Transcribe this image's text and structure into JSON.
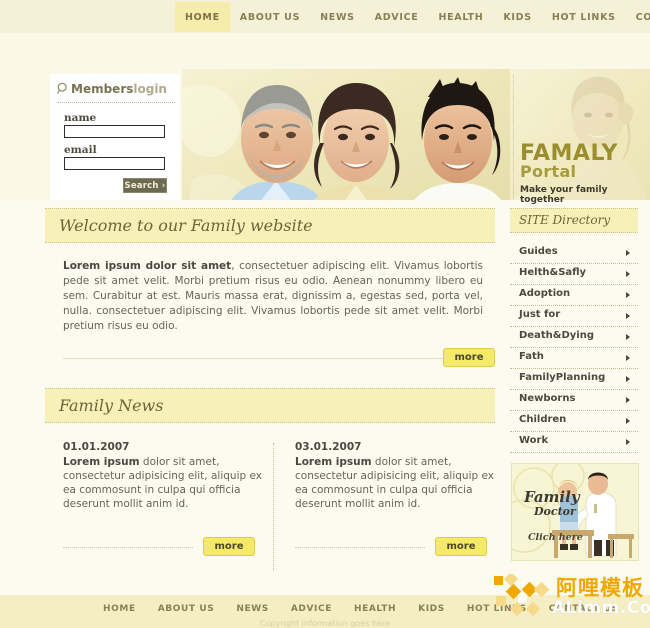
{
  "topnav": {
    "items": [
      {
        "label": "HOME",
        "active": true
      },
      {
        "label": "ABOUT US",
        "active": false
      },
      {
        "label": "NEWS",
        "active": false
      },
      {
        "label": "ADVICE",
        "active": false
      },
      {
        "label": "HEALTH",
        "active": false
      },
      {
        "label": "KIDS",
        "active": false
      },
      {
        "label": "HOT LINKS",
        "active": false
      },
      {
        "label": "CONTACT US",
        "active": false
      }
    ]
  },
  "login": {
    "title_strong": "Members",
    "title_light": "login",
    "icon": "magnifier-icon",
    "name_label": "name",
    "name_value": "",
    "email_label": "email",
    "email_value": "",
    "search_label": "Search ›"
  },
  "banner": {
    "line1": "FAMALY",
    "line2": "Portal",
    "tagline": "Make your family together"
  },
  "welcome": {
    "heading": "Welcome to our Family website",
    "lead": "Lorem ipsum dolor sit amet",
    "body": ", consectetuer adipiscing elit. Vivamus lobortis pede sit amet velit. Morbi pretium risus eu odio. Aenean nonummy libero eu sem. Curabitur at est. Mauris massa erat, dignissim a, egestas sed, porta vel, nulla. consectetuer adipiscing elit. Vivamus lobortis pede sit amet velit. Morbi pretium risus eu odio.",
    "more_label": "more"
  },
  "news": {
    "heading": "Family News",
    "items": [
      {
        "date": "01.01.2007",
        "lead": "Lorem ipsum",
        "body": " dolor sit amet, consectetur adipisicing elit, aliquip ex ea commosunt in culpa qui officia deserunt mollit anim id.",
        "more_label": "more"
      },
      {
        "date": "03.01.2007",
        "lead": "Lorem ipsum",
        "body": " dolor sit amet, consectetur adipisicing elit, aliquip ex ea commosunt in culpa qui officia deserunt mollit anim id.",
        "more_label": "more"
      }
    ]
  },
  "sidebar": {
    "heading": "SITE Directory",
    "items": [
      {
        "label": "Guides"
      },
      {
        "label": "Helth&Safly"
      },
      {
        "label": "Adoption"
      },
      {
        "label": "Just for"
      },
      {
        "label": "Death&Dying"
      },
      {
        "label": "Fath"
      },
      {
        "label": "FamilyPlanning"
      },
      {
        "label": "Newborns"
      },
      {
        "label": "Children"
      },
      {
        "label": "Work"
      }
    ]
  },
  "promo": {
    "line1": "Family",
    "line2": "Doctor",
    "cta": "Clich here"
  },
  "footer": {
    "items": [
      {
        "label": "HOME"
      },
      {
        "label": "ABOUT US"
      },
      {
        "label": "NEWS"
      },
      {
        "label": "ADVICE"
      },
      {
        "label": "HEALTH"
      },
      {
        "label": "KIDS"
      },
      {
        "label": "HOT LINKS"
      },
      {
        "label": "CONTACT US"
      }
    ],
    "copyright": "Copyright information goes here"
  },
  "watermark": {
    "cn": "阿哩模板",
    "en": "ALimm.Com"
  },
  "colors": {
    "page_bg": "#f7f3dd",
    "nav_bg": "#f5f1d8",
    "nav_active_bg": "#f6ecab",
    "nav_text": "#8a8055",
    "content_bg": "#fdfbef",
    "section_head_bg": "#f7f1b9",
    "accent_yellow": "#f5e96a",
    "heading_text": "#6b6438",
    "body_text": "#66645a",
    "watermark_orange": "#f0a800"
  }
}
